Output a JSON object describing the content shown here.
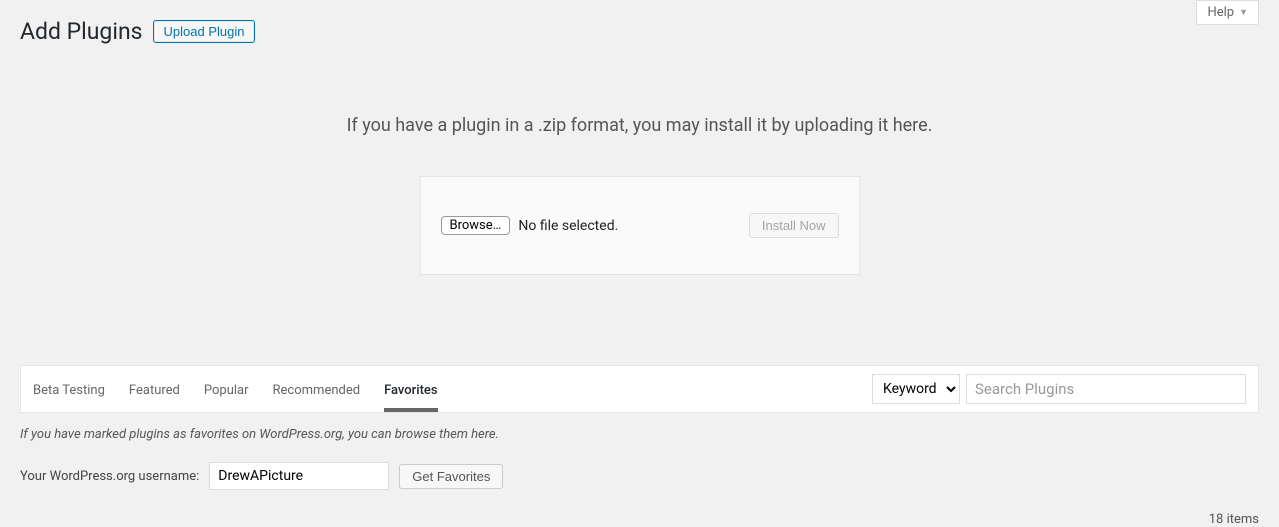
{
  "header": {
    "title": "Add Plugins",
    "upload_button": "Upload Plugin",
    "help_label": "Help"
  },
  "upload": {
    "instruction": "If you have a plugin in a .zip format, you may install it by uploading it here.",
    "browse_label": "Browse…",
    "file_status": "No file selected.",
    "install_label": "Install Now"
  },
  "filter": {
    "tabs": [
      {
        "label": "Beta Testing"
      },
      {
        "label": "Featured"
      },
      {
        "label": "Popular"
      },
      {
        "label": "Recommended"
      },
      {
        "label": "Favorites"
      }
    ],
    "active_tab": 4,
    "search_type": "Keyword",
    "search_placeholder": "Search Plugins"
  },
  "favorites": {
    "description": "If you have marked plugins as favorites on WordPress.org, you can browse them here.",
    "username_label": "Your WordPress.org username:",
    "username_value": "DrewAPicture",
    "get_button": "Get Favorites"
  },
  "results": {
    "count_text": "18 items"
  }
}
